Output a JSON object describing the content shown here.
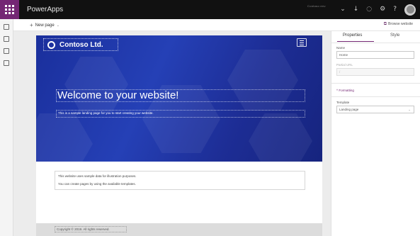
{
  "app": {
    "title": "PowerApps",
    "environment": "Contoso env",
    "accent_color": "#742774",
    "menu_icon": "waffle-icon"
  },
  "topbar": {
    "icons": [
      "chevron-down-icon",
      "download-icon",
      "bell-icon",
      "gear-icon",
      "help-icon",
      "avatar"
    ],
    "glyphs": {
      "chevron": "⌄",
      "download": "↓",
      "bell": "◌",
      "gear": "⚙",
      "help": "?"
    }
  },
  "leftnav": {
    "icons": [
      "home-icon",
      "pages-icon",
      "components-icon",
      "themes-icon"
    ]
  },
  "commandbar": {
    "new_page_label": "New page",
    "plus_glyph": "+",
    "caret_glyph": "⌄",
    "browse_label": "Browse website",
    "browse_glyph": "⧉"
  },
  "site": {
    "company_name": "Contoso Ltd.",
    "hero_color": "#1d3aa8",
    "welcome_heading": "Welcome to your website!",
    "welcome_subtext": "This is a sample landing page for you to start creating your website.",
    "content_lines": [
      "This website uses sample data for illustration purposes.",
      "You can create pages by using the available templates."
    ],
    "copyright": "Copyright © 2019. All rights reserved."
  },
  "properties_panel": {
    "tabs": [
      "Properties",
      "Style"
    ],
    "name_label": "Name",
    "name_value": "Home",
    "partial_url_label": "Partial URL",
    "partial_url_value": "/",
    "formatting_label": "Formatting",
    "formatting_glyph": "^",
    "template_label": "Template",
    "template_value": "Landing page",
    "template_caret": "⌄"
  }
}
